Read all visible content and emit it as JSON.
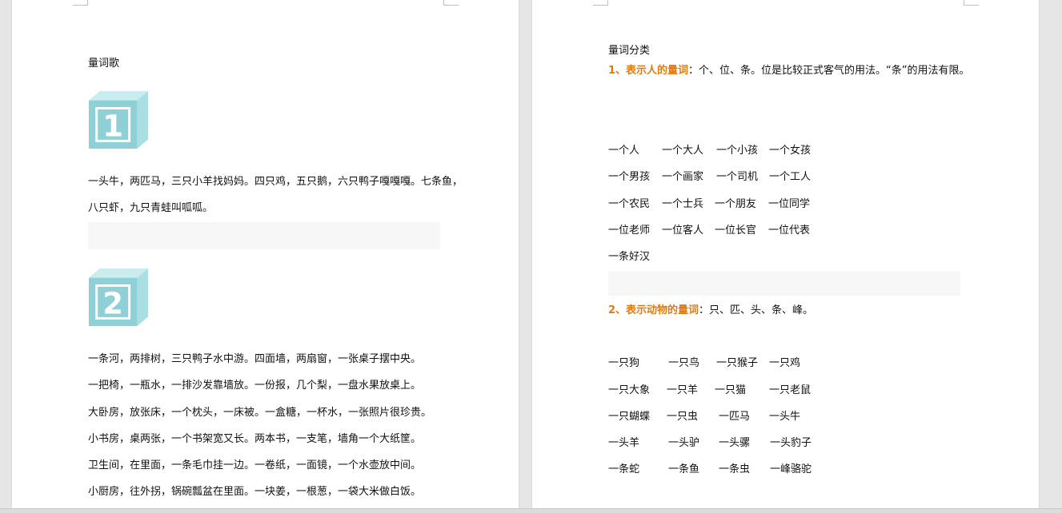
{
  "left_page": {
    "title": "量词歌",
    "section1": {
      "number": "1",
      "line1": "一头牛，两匹马，三只小羊找妈妈。四只鸡，五只鹅，六只鸭子嘎嘎嘎。七条鱼，",
      "line2": "八只虾，九只青蛙叫呱呱。"
    },
    "section2": {
      "number": "2",
      "lines": [
        "一条河，两排树，三只鸭子水中游。四面墙，两扇窗，一张桌子摆中央。",
        "一把椅，一瓶水，一排沙发靠墙放。一份报，几个梨，一盘水果放桌上。",
        "大卧房，放张床，一个枕头，一床被。一盒糖，一杯水，一张照片很珍贵。",
        "小书房，桌两张，一个书架宽又长。两本书，一支笔，墙角一个大纸筐。",
        "卫生间，在里面，一条毛巾挂一边。一卷纸，一面镜，一个水壶放中间。",
        "小厨房，往外拐，锅碗瓢盆在里面。一块姜，一根葱，一袋大米做白饭。"
      ]
    }
  },
  "right_page": {
    "title": "量词分类",
    "cat1": {
      "heading": "1、表示人的量词",
      "desc": "：个、位、条。位是比较正式客气的用法。“条”的用法有限。",
      "rows": [
        [
          "一个人",
          "一个大人",
          "一个小孩",
          "一个女孩"
        ],
        [
          "一个男孩",
          "一个画家",
          "一个司机",
          "一个工人"
        ],
        [
          "一个农民",
          "一个士兵",
          "一个朋友",
          "一位同学"
        ],
        [
          "一位老师",
          "一位客人",
          "一位长官",
          "一位代表"
        ],
        [
          "一条好汉"
        ]
      ]
    },
    "cat2": {
      "heading": "2、表示动物的量词",
      "desc": "：只、匹、头、条、峰。",
      "rows": [
        [
          "一只狗",
          "一只鸟",
          "一只猴子",
          "一只鸡"
        ],
        [
          "一只大象",
          "一只羊",
          "一只猫",
          "一只老鼠"
        ],
        [
          "一只蝴蝶",
          "一只虫",
          "一匹马",
          "一头牛"
        ],
        [
          "一头羊",
          "一头驴",
          "一头骡",
          "一头豹子"
        ],
        [
          "一条蛇",
          "一条鱼",
          "一条虫",
          "一峰骆驼"
        ]
      ]
    }
  },
  "colors": {
    "accent_orange": "#e07a10",
    "cube_teal": "#8fd0d6"
  }
}
